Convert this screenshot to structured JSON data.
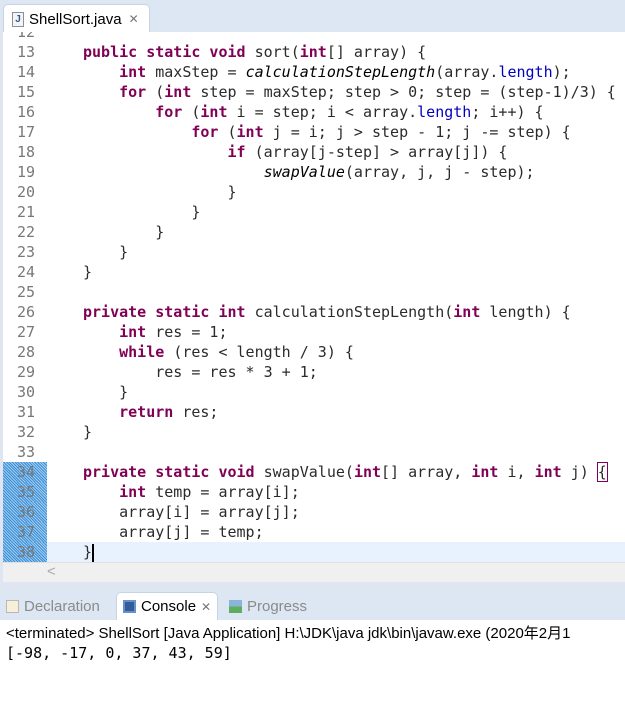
{
  "editor": {
    "tab": "ShellSort.java",
    "first_partial_line": "12",
    "lines": [
      {
        "n": "13",
        "fold": true,
        "t": [
          [
            "k",
            "public static void "
          ],
          [
            "n",
            "sort("
          ],
          [
            "k",
            "int"
          ],
          [
            "n",
            "[] array) {"
          ]
        ]
      },
      {
        "n": "14",
        "t": [
          [
            "k",
            "    int "
          ],
          [
            "n",
            "maxStep = "
          ],
          [
            "i",
            "calculationStepLength"
          ],
          [
            "n",
            "(array."
          ],
          [
            "f",
            "length"
          ],
          [
            "n",
            ");"
          ]
        ]
      },
      {
        "n": "15",
        "t": [
          [
            "k",
            "    for "
          ],
          [
            "n",
            "("
          ],
          [
            "k",
            "int "
          ],
          [
            "n",
            "step = maxStep; step > 0; step = (step-1)/3) {"
          ]
        ]
      },
      {
        "n": "16",
        "t": [
          [
            "k",
            "        for "
          ],
          [
            "n",
            "("
          ],
          [
            "k",
            "int "
          ],
          [
            "n",
            "i = step; i < array."
          ],
          [
            "f",
            "length"
          ],
          [
            "n",
            "; i++) {"
          ]
        ]
      },
      {
        "n": "17",
        "t": [
          [
            "k",
            "            for "
          ],
          [
            "n",
            "("
          ],
          [
            "k",
            "int "
          ],
          [
            "n",
            "j = i; j > step - 1; j -= step) {"
          ]
        ]
      },
      {
        "n": "18",
        "t": [
          [
            "k",
            "                if "
          ],
          [
            "n",
            "(array[j-step] > array[j]) {"
          ]
        ]
      },
      {
        "n": "19",
        "t": [
          [
            "n",
            "                    "
          ],
          [
            "i",
            "swapValue"
          ],
          [
            "n",
            "(array, j, j - step);"
          ]
        ]
      },
      {
        "n": "20",
        "t": [
          [
            "n",
            "                }"
          ]
        ]
      },
      {
        "n": "21",
        "t": [
          [
            "n",
            "            }"
          ]
        ]
      },
      {
        "n": "22",
        "t": [
          [
            "n",
            "        }"
          ]
        ]
      },
      {
        "n": "23",
        "t": [
          [
            "n",
            "    }"
          ]
        ]
      },
      {
        "n": "24",
        "t": [
          [
            "n",
            "}"
          ]
        ]
      },
      {
        "n": "25",
        "t": []
      },
      {
        "n": "26",
        "fold": true,
        "t": [
          [
            "k",
            "private static int "
          ],
          [
            "n",
            "calculationStepLength("
          ],
          [
            "k",
            "int "
          ],
          [
            "n",
            "length) {"
          ]
        ]
      },
      {
        "n": "27",
        "t": [
          [
            "k",
            "    int "
          ],
          [
            "n",
            "res = 1;"
          ]
        ]
      },
      {
        "n": "28",
        "t": [
          [
            "k",
            "    while "
          ],
          [
            "n",
            "(res < length / 3) {"
          ]
        ]
      },
      {
        "n": "29",
        "t": [
          [
            "n",
            "        res = res * 3 + 1;"
          ]
        ]
      },
      {
        "n": "30",
        "t": [
          [
            "n",
            "    }"
          ]
        ]
      },
      {
        "n": "31",
        "t": [
          [
            "k",
            "    return "
          ],
          [
            "n",
            "res;"
          ]
        ]
      },
      {
        "n": "32",
        "t": [
          [
            "n",
            "}"
          ]
        ]
      },
      {
        "n": "33",
        "t": []
      },
      {
        "n": "34",
        "fold": true,
        "mark": true,
        "t": [
          [
            "k",
            "private static void "
          ],
          [
            "n",
            "swapValue("
          ],
          [
            "k",
            "int"
          ],
          [
            "n",
            "[] array, "
          ],
          [
            "k",
            "int "
          ],
          [
            "n",
            "i, "
          ],
          [
            "k",
            "int "
          ],
          [
            "n",
            "j) "
          ],
          [
            "b",
            "{"
          ]
        ]
      },
      {
        "n": "35",
        "mark": true,
        "t": [
          [
            "k",
            "    int "
          ],
          [
            "n",
            "temp = array[i];"
          ]
        ]
      },
      {
        "n": "36",
        "mark": true,
        "t": [
          [
            "n",
            "    array[i] = array[j];"
          ]
        ]
      },
      {
        "n": "37",
        "mark": true,
        "t": [
          [
            "n",
            "    array[j] = temp;"
          ]
        ]
      },
      {
        "n": "38",
        "mark": true,
        "cur": true,
        "t": [
          [
            "n",
            "}"
          ],
          [
            "c",
            ""
          ]
        ]
      }
    ]
  },
  "bottom": {
    "tabs": [
      {
        "label": "Declaration",
        "icon": "declaration-icon"
      },
      {
        "label": "Console",
        "icon": "console-icon",
        "active": true
      },
      {
        "label": "Progress",
        "icon": "progress-icon"
      }
    ],
    "console_header": "<terminated> ShellSort [Java Application] H:\\JDK\\java   jdk\\bin\\javaw.exe (2020年2月1",
    "output": "[-98, -17, 0, 37, 43, 59]"
  },
  "colors": {
    "keyword": "#7f0055",
    "field": "#0000c0",
    "current_line": "#e8f2fe"
  }
}
